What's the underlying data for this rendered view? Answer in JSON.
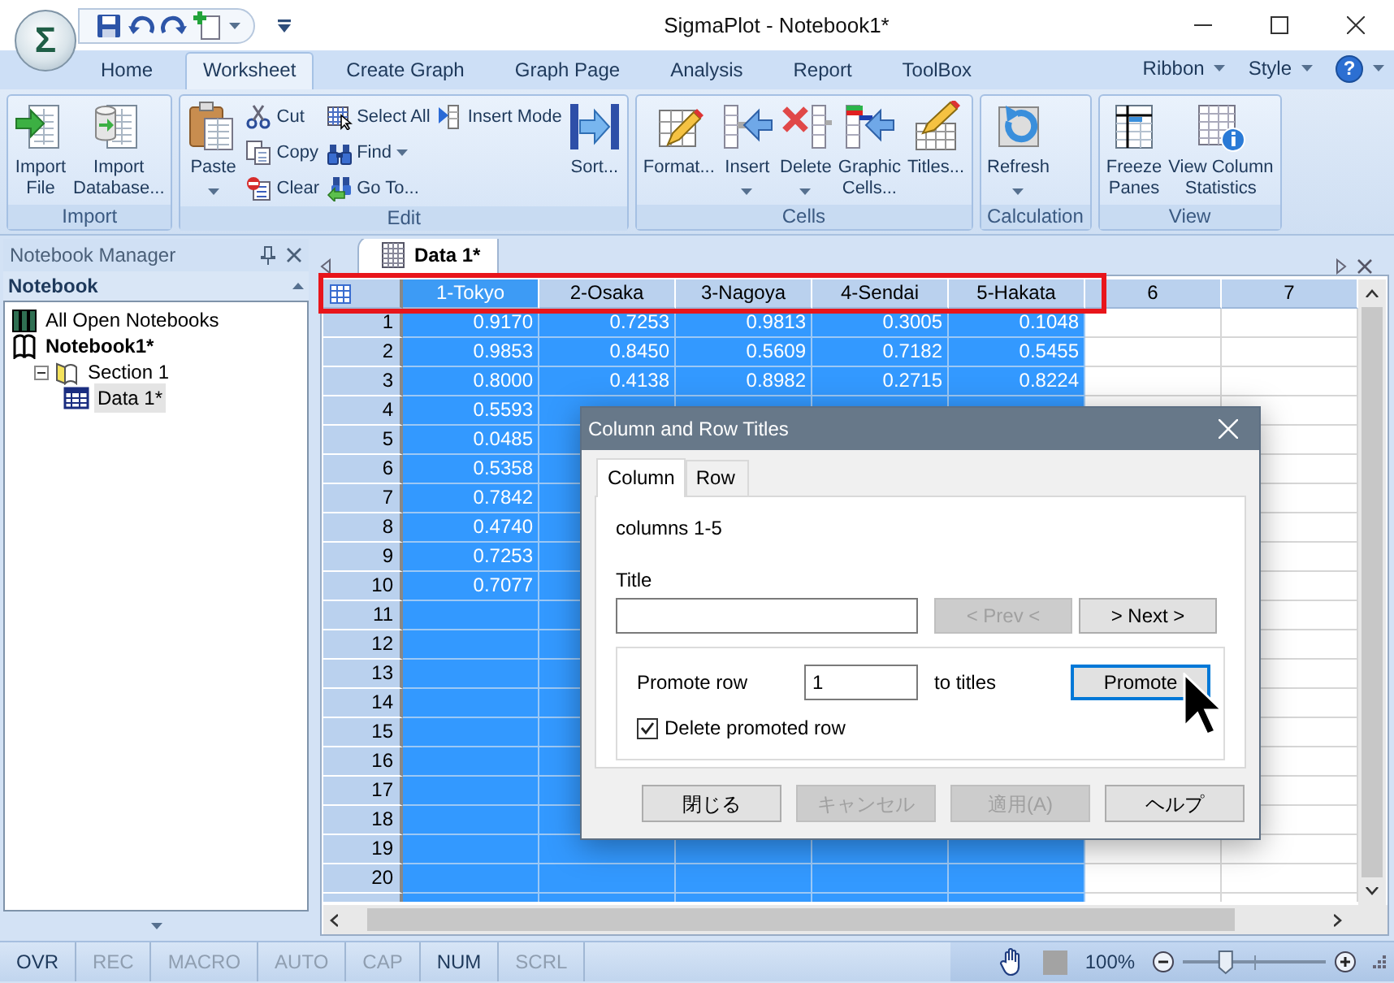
{
  "window": {
    "title": "SigmaPlot - Notebook1*",
    "app_logo": "Σ"
  },
  "ribbon_tabs": [
    {
      "label": "Home",
      "selected": false
    },
    {
      "label": "Worksheet",
      "selected": true
    },
    {
      "label": "Create Graph",
      "selected": false
    },
    {
      "label": "Graph Page",
      "selected": false
    },
    {
      "label": "Analysis",
      "selected": false
    },
    {
      "label": "Report",
      "selected": false
    },
    {
      "label": "ToolBox",
      "selected": false
    }
  ],
  "ribbon_menus": [
    "Ribbon",
    "Style"
  ],
  "help_button": "?",
  "ribbon_groups": [
    {
      "label": "Import",
      "items": [
        {
          "kind": "large",
          "label": "Import\nFile",
          "dropdown": false
        },
        {
          "kind": "large",
          "label": "Import\nDatabase...",
          "dropdown": false
        }
      ]
    },
    {
      "label": "Edit",
      "items": [
        {
          "kind": "large",
          "label": "Paste",
          "dropdown": true
        },
        {
          "kind": "small",
          "label": "Cut",
          "dropdown": false
        },
        {
          "kind": "small",
          "label": "Copy",
          "dropdown": false
        },
        {
          "kind": "small",
          "label": "Clear",
          "dropdown": false
        },
        {
          "kind": "small",
          "label": "Select All",
          "dropdown": false
        },
        {
          "kind": "small",
          "label": "Find",
          "dropdown": true
        },
        {
          "kind": "small",
          "label": "Go To...",
          "dropdown": false
        },
        {
          "kind": "small",
          "label": "Insert Mode",
          "dropdown": false
        },
        {
          "kind": "large",
          "label": "Sort...",
          "dropdown": false
        }
      ]
    },
    {
      "label": "Cells",
      "items": [
        {
          "kind": "large",
          "label": "Format...",
          "dropdown": false
        },
        {
          "kind": "large",
          "label": "Insert",
          "dropdown": true
        },
        {
          "kind": "large",
          "label": "Delete",
          "dropdown": true
        },
        {
          "kind": "large",
          "label": "Graphic\nCells...",
          "dropdown": false
        },
        {
          "kind": "large",
          "label": "Titles...",
          "dropdown": false
        }
      ]
    },
    {
      "label": "Calculation",
      "items": [
        {
          "kind": "large",
          "label": "Refresh",
          "dropdown": true
        }
      ]
    },
    {
      "label": "View",
      "items": [
        {
          "kind": "large",
          "label": "Freeze\nPanes",
          "dropdown": false
        },
        {
          "kind": "large",
          "label": "View Column\nStatistics",
          "dropdown": false
        }
      ]
    }
  ],
  "notebook_manager": {
    "title": "Notebook Manager",
    "section": "Notebook",
    "tree": [
      {
        "label": "All Open Notebooks",
        "kind": "notebooks",
        "selected": false
      },
      {
        "label": "Notebook1*",
        "kind": "notebook",
        "selected": false,
        "children": [
          {
            "label": "Section 1",
            "kind": "section",
            "selected": false,
            "expanded": true,
            "children": [
              {
                "label": "Data 1*",
                "kind": "worksheet",
                "selected": true
              }
            ]
          }
        ]
      }
    ]
  },
  "document_tabs": [
    {
      "label": "Data 1*",
      "selected": true
    }
  ],
  "worksheet": {
    "columns": [
      {
        "title": "1-Tokyo",
        "selected": true,
        "active": true
      },
      {
        "title": "2-Osaka",
        "selected": true,
        "active": false
      },
      {
        "title": "3-Nagoya",
        "selected": true,
        "active": false
      },
      {
        "title": "4-Sendai",
        "selected": true,
        "active": false
      },
      {
        "title": "5-Hakata",
        "selected": true,
        "active": false
      },
      {
        "title": "6",
        "selected": false,
        "active": false
      },
      {
        "title": "7",
        "selected": false,
        "active": false
      }
    ],
    "rows": [
      {
        "number": "1",
        "cells": [
          "0.9170",
          "0.7253",
          "0.9813",
          "0.3005",
          "0.1048"
        ]
      },
      {
        "number": "2",
        "cells": [
          "0.9853",
          "0.8450",
          "0.5609",
          "0.7182",
          "0.5455"
        ]
      },
      {
        "number": "3",
        "cells": [
          "0.8000",
          "0.4138",
          "0.8982",
          "0.2715",
          "0.8224"
        ]
      },
      {
        "number": "4",
        "cells": [
          "0.5593"
        ]
      },
      {
        "number": "5",
        "cells": [
          "0.0485"
        ]
      },
      {
        "number": "6",
        "cells": [
          "0.5358"
        ]
      },
      {
        "number": "7",
        "cells": [
          "0.7842"
        ]
      },
      {
        "number": "8",
        "cells": [
          "0.4740"
        ]
      },
      {
        "number": "9",
        "cells": [
          "0.7253"
        ]
      },
      {
        "number": "10",
        "cells": [
          "0.7077"
        ]
      },
      {
        "number": "11",
        "cells": []
      },
      {
        "number": "12",
        "cells": []
      },
      {
        "number": "13",
        "cells": []
      },
      {
        "number": "14",
        "cells": []
      },
      {
        "number": "15",
        "cells": []
      },
      {
        "number": "16",
        "cells": []
      },
      {
        "number": "17",
        "cells": []
      },
      {
        "number": "18",
        "cells": []
      },
      {
        "number": "19",
        "cells": []
      },
      {
        "number": "20",
        "cells": []
      }
    ]
  },
  "dialog": {
    "title": "Column and Row Titles",
    "tabs": [
      {
        "label": "Column",
        "selected": true
      },
      {
        "label": "Row",
        "selected": false
      }
    ],
    "scope": "columns 1-5",
    "title_label": "Title",
    "nav_buttons": [
      {
        "label": "< Prev <",
        "disabled": true
      },
      {
        "label": "> Next >",
        "disabled": false
      }
    ],
    "promote_label": "Promote row",
    "promote_value": "1",
    "promote_suffix": "to titles",
    "promote_button": {
      "label": "Promote",
      "focused": true
    },
    "delete_promoted_row": {
      "label": "Delete promoted row",
      "checked": true
    },
    "buttons": [
      {
        "label": "閉じる",
        "disabled": false
      },
      {
        "label": "キャンセル",
        "disabled": true
      },
      {
        "label": "適用(A)",
        "disabled": true
      },
      {
        "label": "ヘルプ",
        "disabled": false
      }
    ]
  },
  "status_bar": {
    "indicators": [
      {
        "label": "OVR",
        "on": true
      },
      {
        "label": "REC",
        "on": false
      },
      {
        "label": "MACRO",
        "on": false
      },
      {
        "label": "AUTO",
        "on": false
      },
      {
        "label": "CAP",
        "on": false
      },
      {
        "label": "NUM",
        "on": true
      },
      {
        "label": "SCRL",
        "on": false
      }
    ],
    "zoom": "100%",
    "zoom_slider": {
      "level": 0.3
    }
  }
}
